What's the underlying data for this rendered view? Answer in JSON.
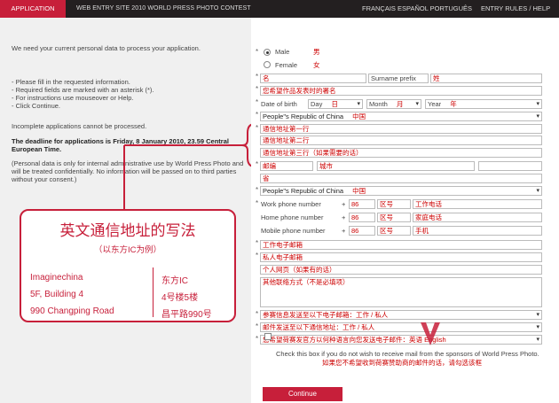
{
  "topbar": {
    "tab": "APPLICATION",
    "site": "WEB ENTRY SITE 2010 WORLD PRESS PHOTO CONTEST",
    "langs": "FRANÇAIS ESPAÑOL PORTUGUÊS",
    "rules": "ENTRY RULES / HELP"
  },
  "left": {
    "p1": "We need your current personal data to process your application.",
    "p2": "- Please fill in the requested information.",
    "p3": "- Required fields are marked with an asterisk (*).",
    "p4": "- For instructions use mouseover or Help.",
    "p5": "- Click Continue.",
    "p6": "Incomplete applications cannot be processed.",
    "p7": "The deadline for applications is Friday, 8 January 2010, 23.59 Central European Time.",
    "p8": "(Personal data is only for internal administrative use by World Press Photo and will be treated confidentially. No information will be passed on to third parties without your consent.)"
  },
  "annotation": {
    "title": "英文通信地址的写法",
    "subtitle": "（以东方IC为例）",
    "en1": "Imaginechina",
    "en2": "5F, Building 4",
    "en3": "990 Changping Road",
    "cn1": "东方IC",
    "cn2": "4号楼5楼",
    "cn3": "昌平路990号"
  },
  "form": {
    "male": "Male",
    "male_cn": "男",
    "female": "Female",
    "female_cn": "女",
    "first_name": "名",
    "surname_prefix": "Surname prefix",
    "surname": "姓",
    "signature": "您希望作品发表时的署名",
    "dob_label": "Date of birth",
    "day": "Day",
    "day_cn": "日",
    "month": "Month",
    "month_cn": "月",
    "year": "Year",
    "year_cn": "年",
    "nationality": "People\"s Republic of China",
    "nationality_cn": "中国",
    "addr1": "通信地址第一行",
    "addr2": "通信地址第二行",
    "addr3": "通信地址第三行（如果需要的话）",
    "postcode": "邮编",
    "city": "城市",
    "province": "省",
    "country": "People\"s Republic of China",
    "country_cn": "中国",
    "work_phone": "Work phone number",
    "home_phone": "Home phone number",
    "mobile_phone": "Mobile phone number",
    "plus": "+",
    "cc": "86",
    "area": "区号",
    "work_num": "工作电话",
    "home_num": "家庭电话",
    "mobile_num": "手机",
    "work_email": "工作电子邮箱",
    "private_email": "私人电子邮箱",
    "website": "个人网页（如果有的话）",
    "other_contact": "其他联络方式（不是必填项）",
    "contest_email": "参赛信息发送至以下电子邮箱：工作 / 私人",
    "mail_to": "邮件发送至以下通信地址：工作 / 私人",
    "language": "您希望荷赛发官方以何种语言向您发送电子邮件：英语 English",
    "check_text": "Check this box if you do not wish to receive mail from the sponsors of World Press Photo.",
    "check_cn": "如果您不希望收到荷赛赞助商的邮件的话，请勾选该框",
    "continue": "Continue"
  }
}
